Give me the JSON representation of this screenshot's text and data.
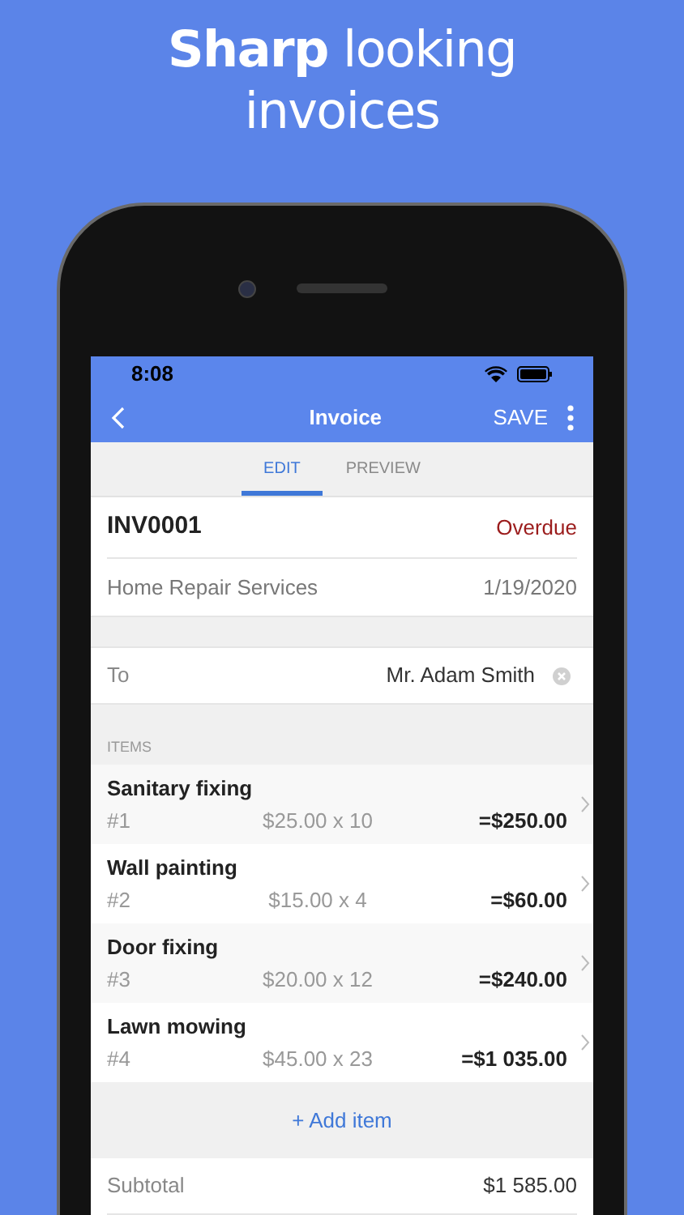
{
  "headline": "**Sharp** looking\ninvoices",
  "status_bar": {
    "time": "8:08"
  },
  "nav": {
    "title": "Invoice",
    "action": "SAVE"
  },
  "tabs": [
    {
      "label": "EDIT",
      "selected": true
    },
    {
      "label": "PREVIEW",
      "selected": false
    }
  ],
  "invoice": {
    "number": "INV0001",
    "status": "Overdue",
    "client": "Home Repair Services",
    "date": "1/19/2020"
  },
  "to": {
    "label": "To",
    "value": "Mr. Adam Smith"
  },
  "items_header": "ITEMS",
  "items": [
    {
      "name": "Sanitary fixing",
      "index": "#1",
      "price": "$25.00 x 10",
      "total": "=$250.00"
    },
    {
      "name": "Wall painting",
      "index": "#2",
      "price": "$15.00 x 4",
      "total": "=$60.00"
    },
    {
      "name": "Door fixing",
      "index": "#3",
      "price": "$20.00 x 12",
      "total": "=$240.00"
    },
    {
      "name": "Lawn mowing",
      "index": "#4",
      "price": "$45.00 x 23",
      "total": "=$1 035.00"
    }
  ],
  "add_item": "+ Add item",
  "subtotal": {
    "label": "Subtotal",
    "value": "$1 585.00"
  }
}
